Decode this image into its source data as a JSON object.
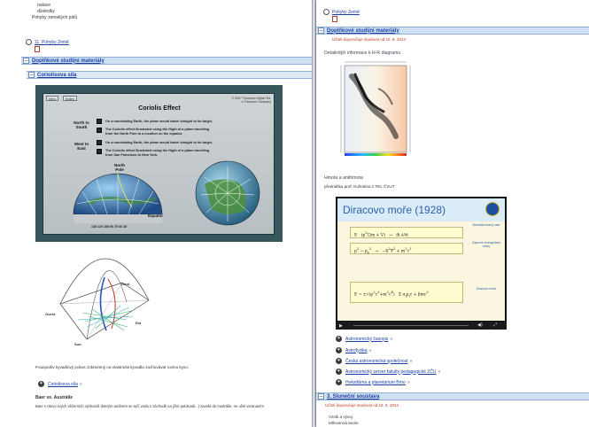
{
  "left": {
    "top_lines": [
      "nutace",
      "düsledky",
      "Pohyby zemských pólů"
    ],
    "lesson_link": "11. Pohyby Země",
    "section_title": "Doplňkové studijní materiály",
    "subsection_title": "Coriolisova síla",
    "coriolis": {
      "tabs": [
        "Intro",
        "Index"
      ],
      "title": "Coriolis Effect",
      "copyright": [
        "© 2007 Thomson Higher Ed.",
        "a Thomson Company"
      ],
      "rows": [
        {
          "label": "North to South",
          "lines": [
            "On a nonrotating Earth, the plane would travel straight to its target.",
            "The Coriolis effect illustrated using the flight of a plane travelling",
            "from the North Pole to a location on the equator."
          ]
        },
        {
          "label": "West to East",
          "lines": [
            "On a nonrotating Earth, the plane would travel straight to its target.",
            "The Coriolis effect illustrated using the flight of a plane travelling",
            "from San Francisco to New York."
          ]
        }
      ],
      "north_pole_label": "North Pole",
      "equator_label": "Equator",
      "longitudes": "135 120 105 90 75 60 45"
    },
    "diagram_labels": {
      "north": "Nord",
      "south": "Sud",
      "east": "Est",
      "west": "Ouest"
    },
    "caption": "Pousputův kyvadlový pokus zobrazený na vlastnosti kyvadla zachovávat rovinu kyvu.",
    "link_item": "Coriolisova síla",
    "bottom_title": "Baer vs. Austrálie",
    "bottom_text": "Baer v rámci svých věčerních výzkumů (kterým aměrem se točí voda v záchodě na jižní polokouli...) zavolá do Austrálie, ne užel vzrananím"
  },
  "right": {
    "top_link": "Pohyby Země",
    "section_title": "Doplňkové studijní materiály",
    "note": "Učitel doporučuje studovat od 15. 8. 2014",
    "hr_caption": "Detailnější informace k H-R diagramu",
    "mass_title": "Hmota a antihmota",
    "mass_sub": "přednáška prof. Kuhnáina z FEL ČVUT",
    "video_title": "Diracovo moře (1928)",
    "video_notes": [
      "Nelokalizovaný stav",
      "Záporné energetické stavy",
      "Diracovo moře"
    ],
    "links": [
      "Astronomický časopis",
      "Astrofyzika",
      "Česká astronomická společnost",
      "Astronomický server fakulty pedagogické ZČU",
      "Hvězdárna a planetárium Brno"
    ],
    "section3_title": "3. Sluneční soustava",
    "section3_note": "Učitel doporučuje studovat od 15. 8. 2014",
    "bottom_lines": [
      "Vznik a vývoj",
      "Mlhovinná teorie"
    ]
  }
}
